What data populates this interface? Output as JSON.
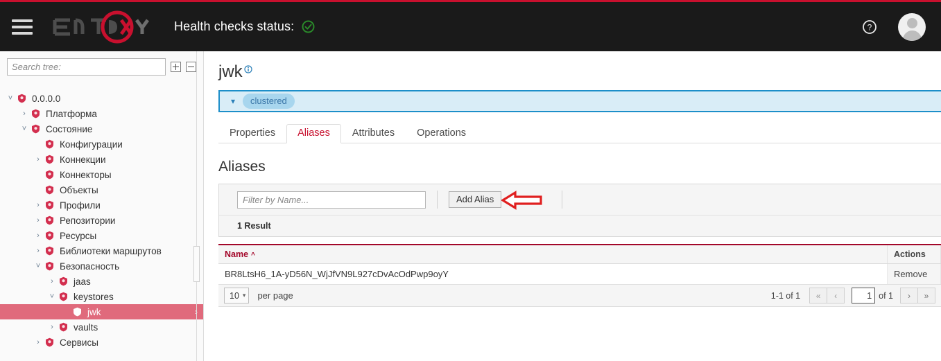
{
  "header": {
    "menu_icon": "hamburger-icon",
    "logo_text": "ENTAXY",
    "health_label": "Health checks status:",
    "health_state_icon": "check-circle-ok-icon",
    "help_icon": "help-circle-icon",
    "avatar_icon": "user-avatar-icon"
  },
  "sidebar": {
    "search_placeholder": "Search tree:",
    "search_value": "",
    "expand_all_icon": "plus-box-icon",
    "collapse_all_icon": "minus-box-icon",
    "tree": [
      {
        "label": "0.0.0.0",
        "depth": 0,
        "caret": "down",
        "icon": "container-icon",
        "selected": false
      },
      {
        "label": "Платформа",
        "depth": 1,
        "caret": "right",
        "icon": "platform-icon",
        "selected": false
      },
      {
        "label": "Состояние",
        "depth": 1,
        "caret": "down",
        "icon": "state-icon",
        "selected": false
      },
      {
        "label": "Конфигурации",
        "depth": 2,
        "caret": "none",
        "icon": "config-icon",
        "selected": false
      },
      {
        "label": "Коннекции",
        "depth": 2,
        "caret": "right",
        "icon": "connections-icon",
        "selected": false
      },
      {
        "label": "Коннекторы",
        "depth": 2,
        "caret": "none",
        "icon": "connectors-icon",
        "selected": false
      },
      {
        "label": "Объекты",
        "depth": 2,
        "caret": "none",
        "icon": "objects-icon",
        "selected": false
      },
      {
        "label": "Профили",
        "depth": 2,
        "caret": "right",
        "icon": "profiles-icon",
        "selected": false
      },
      {
        "label": "Репозитории",
        "depth": 2,
        "caret": "right",
        "icon": "repositories-icon",
        "selected": false
      },
      {
        "label": "Ресурсы",
        "depth": 2,
        "caret": "right",
        "icon": "resources-icon",
        "selected": false
      },
      {
        "label": "Библиотеки маршрутов",
        "depth": 2,
        "caret": "right",
        "icon": "route-libraries-icon",
        "selected": false
      },
      {
        "label": "Безопасность",
        "depth": 2,
        "caret": "down",
        "icon": "security-shield-icon",
        "selected": false
      },
      {
        "label": "jaas",
        "depth": 3,
        "caret": "right",
        "icon": "security-shield-icon",
        "selected": false
      },
      {
        "label": "keystores",
        "depth": 3,
        "caret": "down",
        "icon": "security-shield-icon",
        "selected": false
      },
      {
        "label": "jwk",
        "depth": 4,
        "caret": "none",
        "icon": "security-shield-icon",
        "selected": true
      },
      {
        "label": "vaults",
        "depth": 3,
        "caret": "right",
        "icon": "security-shield-icon",
        "selected": false
      },
      {
        "label": "Сервисы",
        "depth": 2,
        "caret": "right",
        "icon": "services-icon",
        "selected": false
      }
    ]
  },
  "main": {
    "page_title": "jwk",
    "page_title_info_icon": "info-circle-icon",
    "clustered": {
      "caret_icon": "chevron-down-icon",
      "pill_label": "clustered"
    },
    "tabs": [
      {
        "label": "Properties",
        "active": false
      },
      {
        "label": "Aliases",
        "active": true
      },
      {
        "label": "Attributes",
        "active": false
      },
      {
        "label": "Operations",
        "active": false
      }
    ],
    "section_title": "Aliases",
    "toolbar": {
      "filter_placeholder": "Filter by Name...",
      "filter_value": "",
      "add_alias_label": "Add Alias"
    },
    "result_count_text": "1 Result",
    "table": {
      "columns": [
        "Name",
        "Actions"
      ],
      "sort_column": "Name",
      "sort_direction_icon": "caret-up-icon",
      "rows": [
        {
          "name": "BR8LtsH6_1A-yD56N_WjJfVN9L927cDvAcOdPwp9oyY",
          "action": "Remove"
        }
      ]
    },
    "pagination": {
      "per_page_value": "10",
      "per_page_label": "per page",
      "range_text": "1-1 of 1",
      "first_icon": "double-chevron-left-icon",
      "prev_icon": "chevron-left-icon",
      "current_page": "1",
      "of_text": "of 1",
      "next_icon": "chevron-right-icon",
      "last_icon": "double-chevron-right-icon"
    }
  },
  "annotation": {
    "arrow_icon": "arrow-left-callout-icon",
    "arrow_color": "#e02020"
  },
  "colors": {
    "brand_red": "#c8102e",
    "header_bg": "#1a1a1a",
    "accent_blue": "#1d8fc9",
    "selected_row": "#e06a7c",
    "ok_green": "#2a8a2a"
  }
}
